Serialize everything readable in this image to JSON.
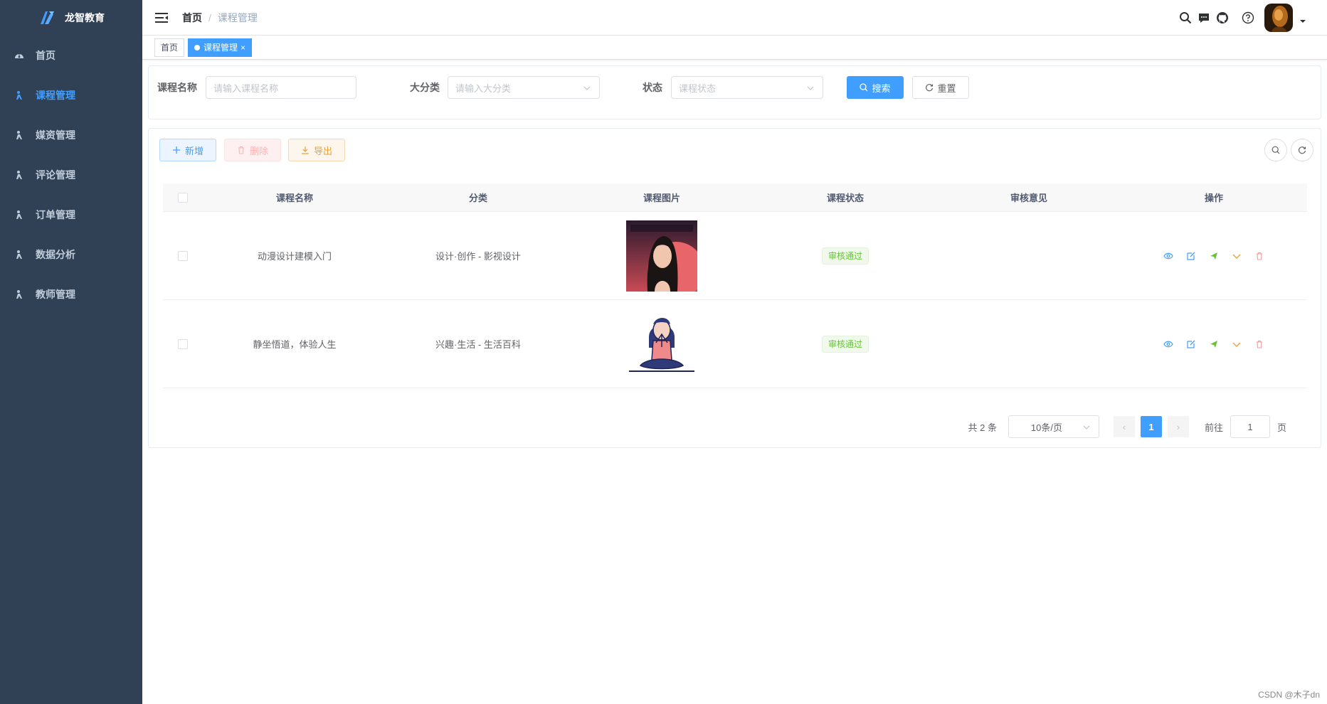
{
  "app": {
    "logo_text": "龙智教育"
  },
  "sidebar": {
    "items": [
      {
        "label": "首页",
        "icon": "dashboard-icon",
        "active": false
      },
      {
        "label": "课程管理",
        "icon": "person-icon",
        "active": true
      },
      {
        "label": "媒资管理",
        "icon": "person-icon",
        "active": false
      },
      {
        "label": "评论管理",
        "icon": "person-icon",
        "active": false
      },
      {
        "label": "订单管理",
        "icon": "person-icon",
        "active": false
      },
      {
        "label": "数据分析",
        "icon": "person-icon",
        "active": false
      },
      {
        "label": "教师管理",
        "icon": "person-icon",
        "active": false
      }
    ]
  },
  "breadcrumb": {
    "home": "首页",
    "separator": "/",
    "current": "课程管理"
  },
  "tags": {
    "home": "首页",
    "active": "课程管理",
    "close": "×"
  },
  "search": {
    "name_label": "课程名称",
    "name_placeholder": "请输入课程名称",
    "category_label": "大分类",
    "category_placeholder": "请输入大分类",
    "status_label": "状态",
    "status_placeholder": "课程状态",
    "search_button": "搜索",
    "reset_button": "重置"
  },
  "toolbar": {
    "add": "新增",
    "delete": "删除",
    "export": "导出"
  },
  "table": {
    "columns": [
      "课程名称",
      "分类",
      "课程图片",
      "课程状态",
      "审核意见",
      "操作"
    ],
    "rows": [
      {
        "name": "动漫设计建模入门",
        "category": "设计·创作 - 影视设计",
        "image": "anime-3d-character-image",
        "status": "审核通过",
        "review": ""
      },
      {
        "name": "静坐悟道，体验人生",
        "category": "兴趣·生活 - 生活百科",
        "image": "meditation-figure-image",
        "status": "审核通过",
        "review": ""
      }
    ]
  },
  "pagination": {
    "total": "共 2 条",
    "page_size": "10条/页",
    "current_page": "1",
    "goto_label": "前往",
    "goto_value": "1",
    "page_suffix": "页",
    "prev": "‹",
    "next": "›"
  },
  "watermark": "CSDN @木子dn",
  "colors": {
    "sidebar_bg": "#304156",
    "primary": "#409eff",
    "success": "#67c23a",
    "warning": "#e6a23c",
    "danger": "#f56c6c"
  }
}
